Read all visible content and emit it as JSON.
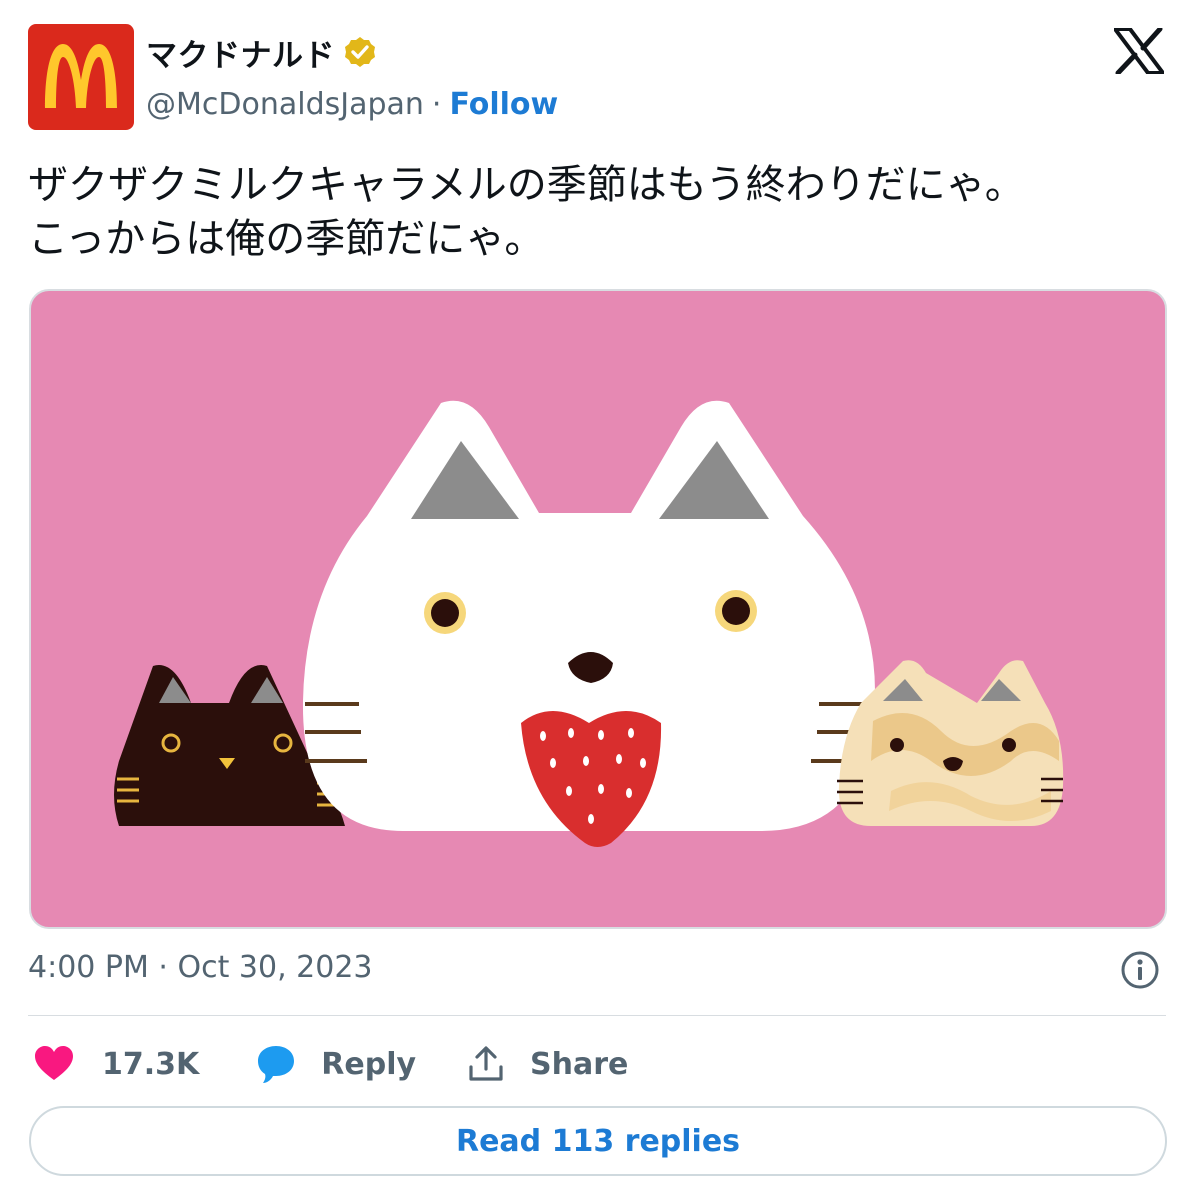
{
  "author": {
    "display_name": "マクドナルド",
    "handle": "@McDonaldsJapan",
    "separator": "·",
    "follow_label": "Follow",
    "verified_color": "#e2b719",
    "avatar_bg": "#da291c",
    "avatar_logo_color": "#ffc72c"
  },
  "tweet": {
    "text": "ザクザクミルクキャラメルの季節はもう終わりだにゃ。\nこっからは俺の季節だにゃ。",
    "timestamp": "4:00 PM · Oct 30, 2023"
  },
  "media": {
    "background": "#e689b3",
    "subjects": [
      "white-cat-with-strawberry",
      "black-cat",
      "caramel-swirl-cat"
    ]
  },
  "engagement": {
    "likes": "17.3K",
    "reply_label": "Reply",
    "share_label": "Share",
    "read_replies_label": "Read 113 replies"
  },
  "colors": {
    "accent": "#1d7bd4",
    "like": "#f91880",
    "reply_icon": "#1d9bf0",
    "muted": "#536471"
  }
}
